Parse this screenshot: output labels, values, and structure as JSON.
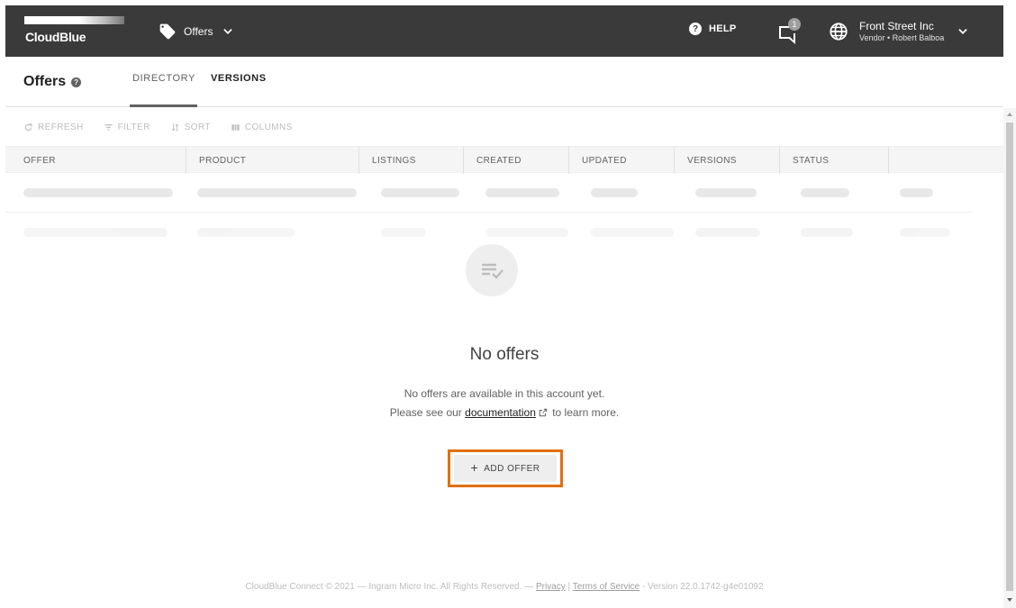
{
  "topbar": {
    "logo_text": "CloudBlue",
    "module_label": "Offers",
    "help_label": "HELP",
    "notification_count": "1",
    "account_name": "Front Street Inc",
    "account_role": "Vendor • Robert Balboa",
    "background_color": "#3a3a3a"
  },
  "header": {
    "title": "Offers",
    "tabs": [
      {
        "label": "DIRECTORY"
      },
      {
        "label": "VERSIONS"
      }
    ]
  },
  "toolbar": {
    "refresh_label": "REFRESH",
    "filter_label": "FILTER",
    "sort_label": "SORT",
    "columns_label": "COLUMNS"
  },
  "table": {
    "columns": [
      "OFFER",
      "PRODUCT",
      "LISTINGS",
      "CREATED",
      "UPDATED",
      "VERSIONS",
      "STATUS",
      ""
    ]
  },
  "empty_state": {
    "title": "No offers",
    "line1": "No offers are available in this account yet.",
    "line2_prefix": "Please see our",
    "link_text": "documentation",
    "line2_suffix": "to learn more.",
    "button_label": "ADD OFFER",
    "highlight_color": "#e07010"
  },
  "footer": {
    "copyright": "CloudBlue Connect © 2021 — Ingram Micro Inc. All Rights Reserved. —",
    "privacy": "Privacy",
    "separator": "|",
    "terms": "Terms of Service",
    "version": "- Version 22.0.1742-g4e01092"
  }
}
